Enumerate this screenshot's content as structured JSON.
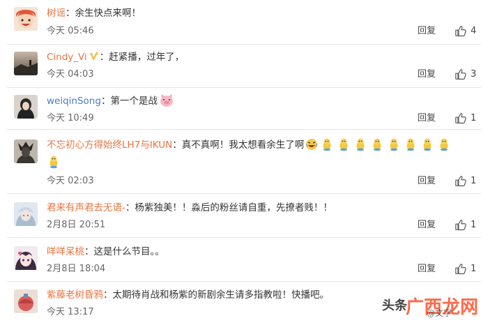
{
  "reply_label": "回复",
  "watermark": {
    "prefix": "头条",
    "brand": "广西龙网",
    "sub": "@文字"
  },
  "comments": [
    {
      "user": "树谣",
      "sep": "：",
      "text": "余生快点来啊！",
      "time": "今天 05:46",
      "likes": "4"
    },
    {
      "user": "Cindy_Vi",
      "sep": "：",
      "text": "赶紧播，过年了，",
      "time": "今天 04:03",
      "likes": "3"
    },
    {
      "user": "weiqinSong",
      "sep": "：",
      "text": "第一个是战",
      "time": "今天 10:49",
      "likes": "1"
    },
    {
      "user": "不忘初心方得始终LH7与IKUN",
      "sep": "：",
      "text": "真不真啊！我太想看余生了啊",
      "time": "今天 02:03",
      "likes": "1"
    },
    {
      "user": "君来有声君去无语-",
      "sep": "：",
      "text": "杨紫独美！！淼后的粉丝请自重，先撩者贱！！",
      "time": "2月8日 20:51",
      "likes": "1"
    },
    {
      "user": "咩咩呆桃",
      "sep": "：",
      "text": "这是什么节目。。",
      "time": "2月8日 18:04",
      "likes": "1"
    },
    {
      "user": "紫藤老树昏鸦",
      "sep": "：",
      "text": "太期待肖战和杨紫的新剧余生请多指教啦！快播吧。",
      "time": "今天 13:17",
      "likes": ""
    }
  ]
}
